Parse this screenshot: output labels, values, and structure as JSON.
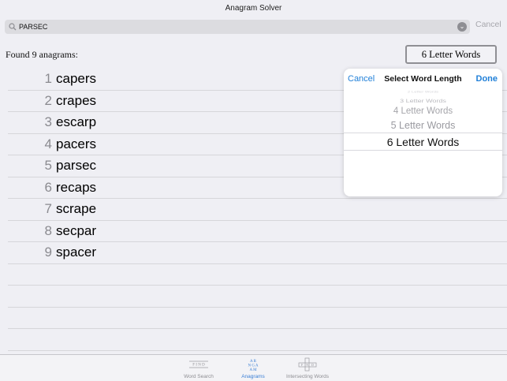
{
  "window": {
    "title": "Anagram Solver"
  },
  "search": {
    "value": "PARSEC",
    "cancel_label": "Cancel"
  },
  "results": {
    "summary": "Found 9 anagrams:",
    "length_button": "6 Letter Words",
    "items": [
      {
        "num": "1",
        "word": "capers"
      },
      {
        "num": "2",
        "word": "crapes"
      },
      {
        "num": "3",
        "word": "escarp"
      },
      {
        "num": "4",
        "word": "pacers"
      },
      {
        "num": "5",
        "word": "parsec"
      },
      {
        "num": "6",
        "word": "recaps"
      },
      {
        "num": "7",
        "word": "scrape"
      },
      {
        "num": "8",
        "word": "secpar"
      },
      {
        "num": "9",
        "word": "spacer"
      }
    ]
  },
  "popover": {
    "cancel_label": "Cancel",
    "title": "Select Word Length",
    "done_label": "Done",
    "options": [
      "2 Letter Words",
      "3 Letter Words",
      "4 Letter Words",
      "5 Letter Words",
      "6 Letter Words"
    ],
    "selected": "6 Letter Words"
  },
  "tabs": [
    {
      "label": "Word Search",
      "icon": "word-search-grid-icon",
      "active": false
    },
    {
      "label": "Anagrams",
      "icon": "anagram-letters-icon",
      "active": true
    },
    {
      "label": "Intersecting Words",
      "icon": "crossword-grid-icon",
      "active": false
    }
  ],
  "colors": {
    "accent": "#1f7fd8",
    "background": "#efeff4"
  }
}
